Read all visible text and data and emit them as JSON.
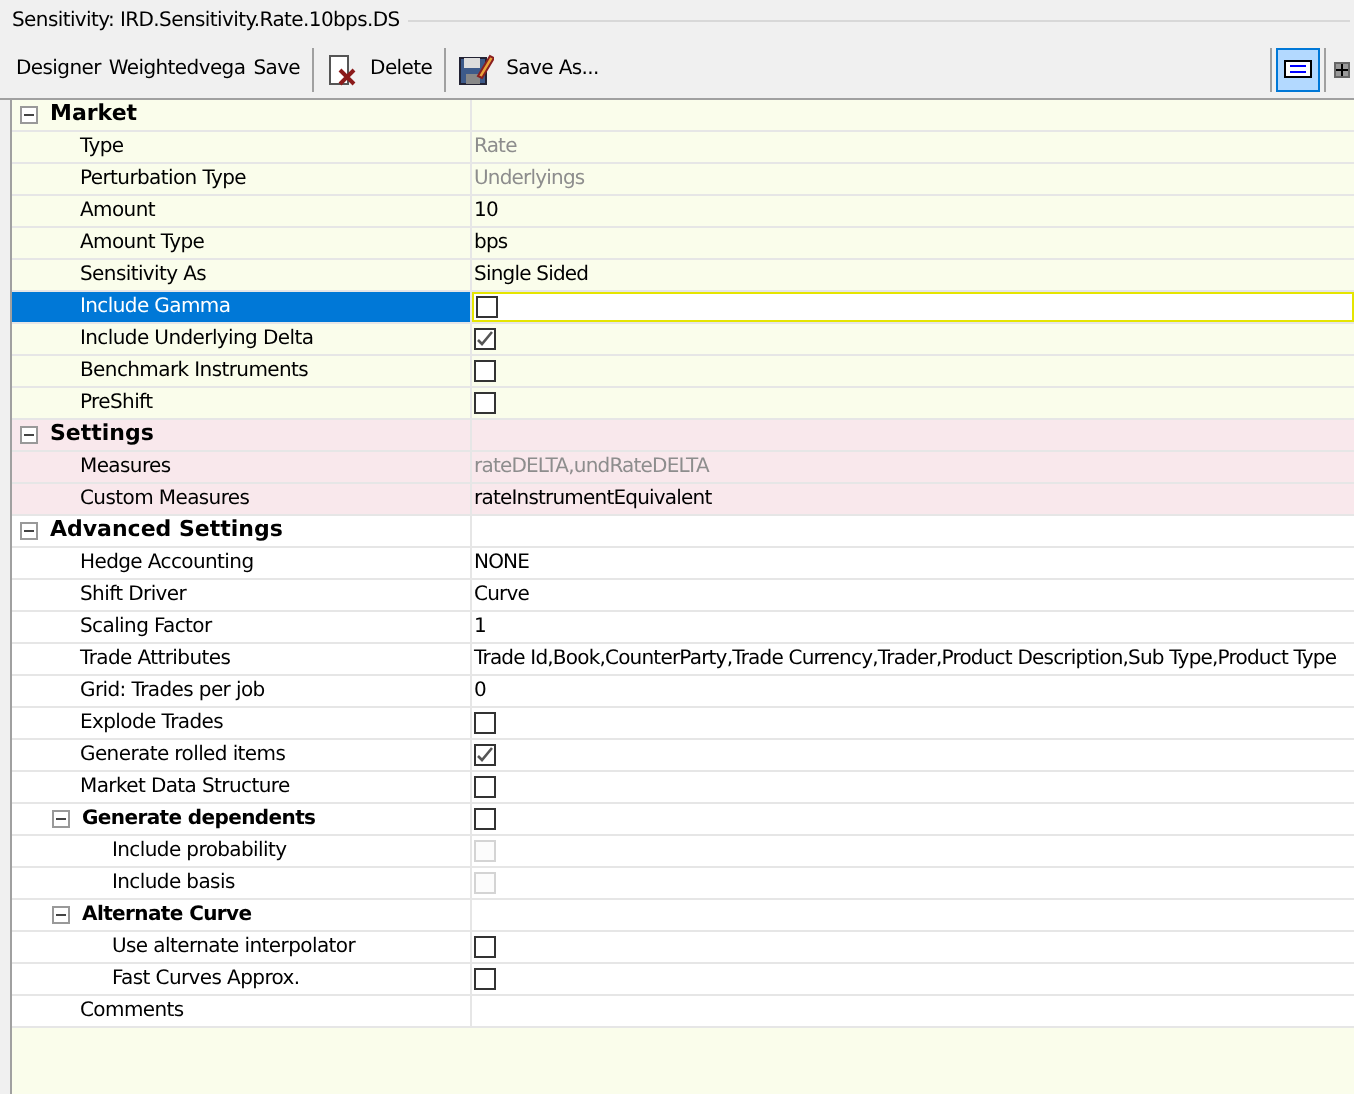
{
  "group_title": "Sensitivity: IRD.Sensitivity.Rate.10bps.DS",
  "toolbar": [
    {
      "kind": "text",
      "label": "Designer"
    },
    {
      "kind": "text",
      "label": "Weightedvega"
    },
    {
      "kind": "text",
      "label": "Save"
    },
    {
      "kind": "separator"
    },
    {
      "kind": "delete",
      "label": "Delete"
    },
    {
      "kind": "separator"
    },
    {
      "kind": "saveas",
      "label": "Save As..."
    }
  ],
  "view_toggle": {
    "selected": true
  },
  "sections": [
    {
      "label": "Market",
      "expanded": true,
      "color": "#fafdeb",
      "items": [
        {
          "label": "Type",
          "kind": "text",
          "value": "Rate",
          "disabled": true,
          "selected": false
        },
        {
          "label": "Perturbation Type",
          "kind": "text",
          "value": "Underlyings",
          "disabled": true,
          "selected": false
        },
        {
          "label": "Amount",
          "kind": "text",
          "value": "10",
          "selected": false
        },
        {
          "label": "Amount Type",
          "kind": "text",
          "value": "bps",
          "selected": false
        },
        {
          "label": "Sensitivity As",
          "kind": "text",
          "value": "Single Sided",
          "selected": false
        },
        {
          "label": "Include Gamma",
          "kind": "checkbox",
          "checked": false,
          "selected": true
        },
        {
          "label": "Include Underlying Delta",
          "kind": "checkbox",
          "checked": true,
          "selected": false
        },
        {
          "label": "Benchmark Instruments",
          "kind": "checkbox",
          "checked": false,
          "selected": false
        },
        {
          "label": "PreShift",
          "kind": "checkbox",
          "checked": false,
          "selected": false
        }
      ]
    },
    {
      "label": "Settings",
      "expanded": true,
      "color": "#f9e8ec",
      "items": [
        {
          "label": "Measures",
          "kind": "text",
          "value": "rateDELTA,undRateDELTA",
          "disabled": true,
          "selected": false
        },
        {
          "label": "Custom Measures",
          "kind": "text",
          "value": "rateInstrumentEquivalent",
          "selected": false
        }
      ]
    },
    {
      "label": "Advanced Settings",
      "expanded": true,
      "color": "#ffffff",
      "items": [
        {
          "label": "Hedge Accounting",
          "kind": "text",
          "value": "NONE",
          "selected": false
        },
        {
          "label": "Shift Driver",
          "kind": "text",
          "value": "Curve",
          "selected": false
        },
        {
          "label": "Scaling Factor",
          "kind": "text",
          "value": "1",
          "selected": false
        },
        {
          "label": "Trade Attributes",
          "kind": "text",
          "value": "Trade Id,Book,CounterParty,Trade Currency,Trader,Product Description,Sub Type,Product Type",
          "selected": false
        },
        {
          "label": "Grid: Trades per job",
          "kind": "text",
          "value": "0",
          "selected": false
        },
        {
          "label": "Explode Trades",
          "kind": "checkbox",
          "checked": false,
          "selected": false
        },
        {
          "label": "Generate rolled items",
          "kind": "checkbox",
          "checked": true,
          "selected": false
        },
        {
          "label": "Market Data Structure",
          "kind": "checkbox",
          "checked": false,
          "selected": false
        },
        {
          "label": "Generate dependents",
          "kind": "checkbox",
          "checked": false,
          "selected": false,
          "expanded": true,
          "children": [
            {
              "label": "Include probability",
              "kind": "checkbox",
              "checked": false,
              "disabled": true,
              "selected": false
            },
            {
              "label": "Include basis",
              "kind": "checkbox",
              "checked": false,
              "disabled": true,
              "selected": false
            }
          ]
        },
        {
          "label": "Alternate Curve",
          "kind": "group",
          "selected": false,
          "expanded": true,
          "children": [
            {
              "label": "Use alternate interpolator",
              "kind": "checkbox",
              "checked": false,
              "selected": false
            },
            {
              "label": "Fast Curves Approx.",
              "kind": "checkbox",
              "checked": false,
              "selected": false
            }
          ]
        },
        {
          "label": "Comments",
          "kind": "text",
          "selected": false
        }
      ]
    }
  ]
}
